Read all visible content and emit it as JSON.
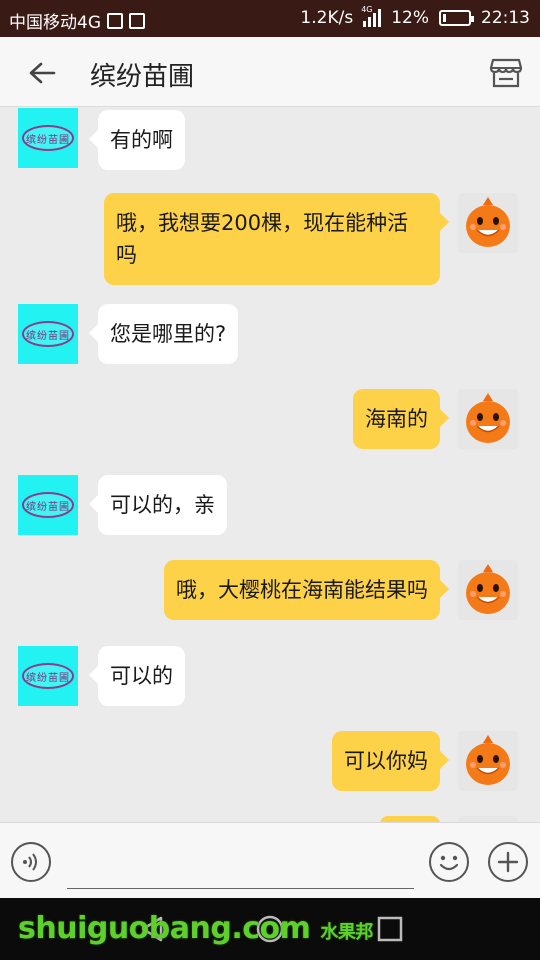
{
  "status_bar": {
    "carrier": "中国移动4G",
    "speed": "1.2K/s",
    "network_tag": "4G",
    "battery": "12%",
    "battery_level": 0.12,
    "time": "22:13"
  },
  "header": {
    "title": "缤纷苗圃",
    "back_icon": "arrow-left-icon",
    "shop_icon": "storefront-icon"
  },
  "contact_avatar_text": "缤纷苗圃",
  "messages": [
    {
      "side": "in",
      "text": "有的啊"
    },
    {
      "side": "out",
      "text": "哦，我想要200棵，现在能种活吗"
    },
    {
      "side": "in",
      "text": "您是哪里的?"
    },
    {
      "side": "out",
      "text": "海南的"
    },
    {
      "side": "in",
      "text": "可以的，亲"
    },
    {
      "side": "out",
      "text": "哦，大樱桃在海南能结果吗"
    },
    {
      "side": "in",
      "text": "可以的"
    },
    {
      "side": "out",
      "text": "可以你妈"
    }
  ],
  "input": {
    "value": "",
    "voice_icon": "voice-icon",
    "emoji_icon": "emoji-icon",
    "plus_icon": "plus-icon"
  },
  "watermark": {
    "text": "shuiguobang.com",
    "chinese": "水果邦"
  },
  "colors": {
    "outgoing_bubble": "#fdd148",
    "incoming_bubble": "#ffffff",
    "chat_background": "#ebebeb",
    "avatar_bg": "#23f2f2"
  }
}
